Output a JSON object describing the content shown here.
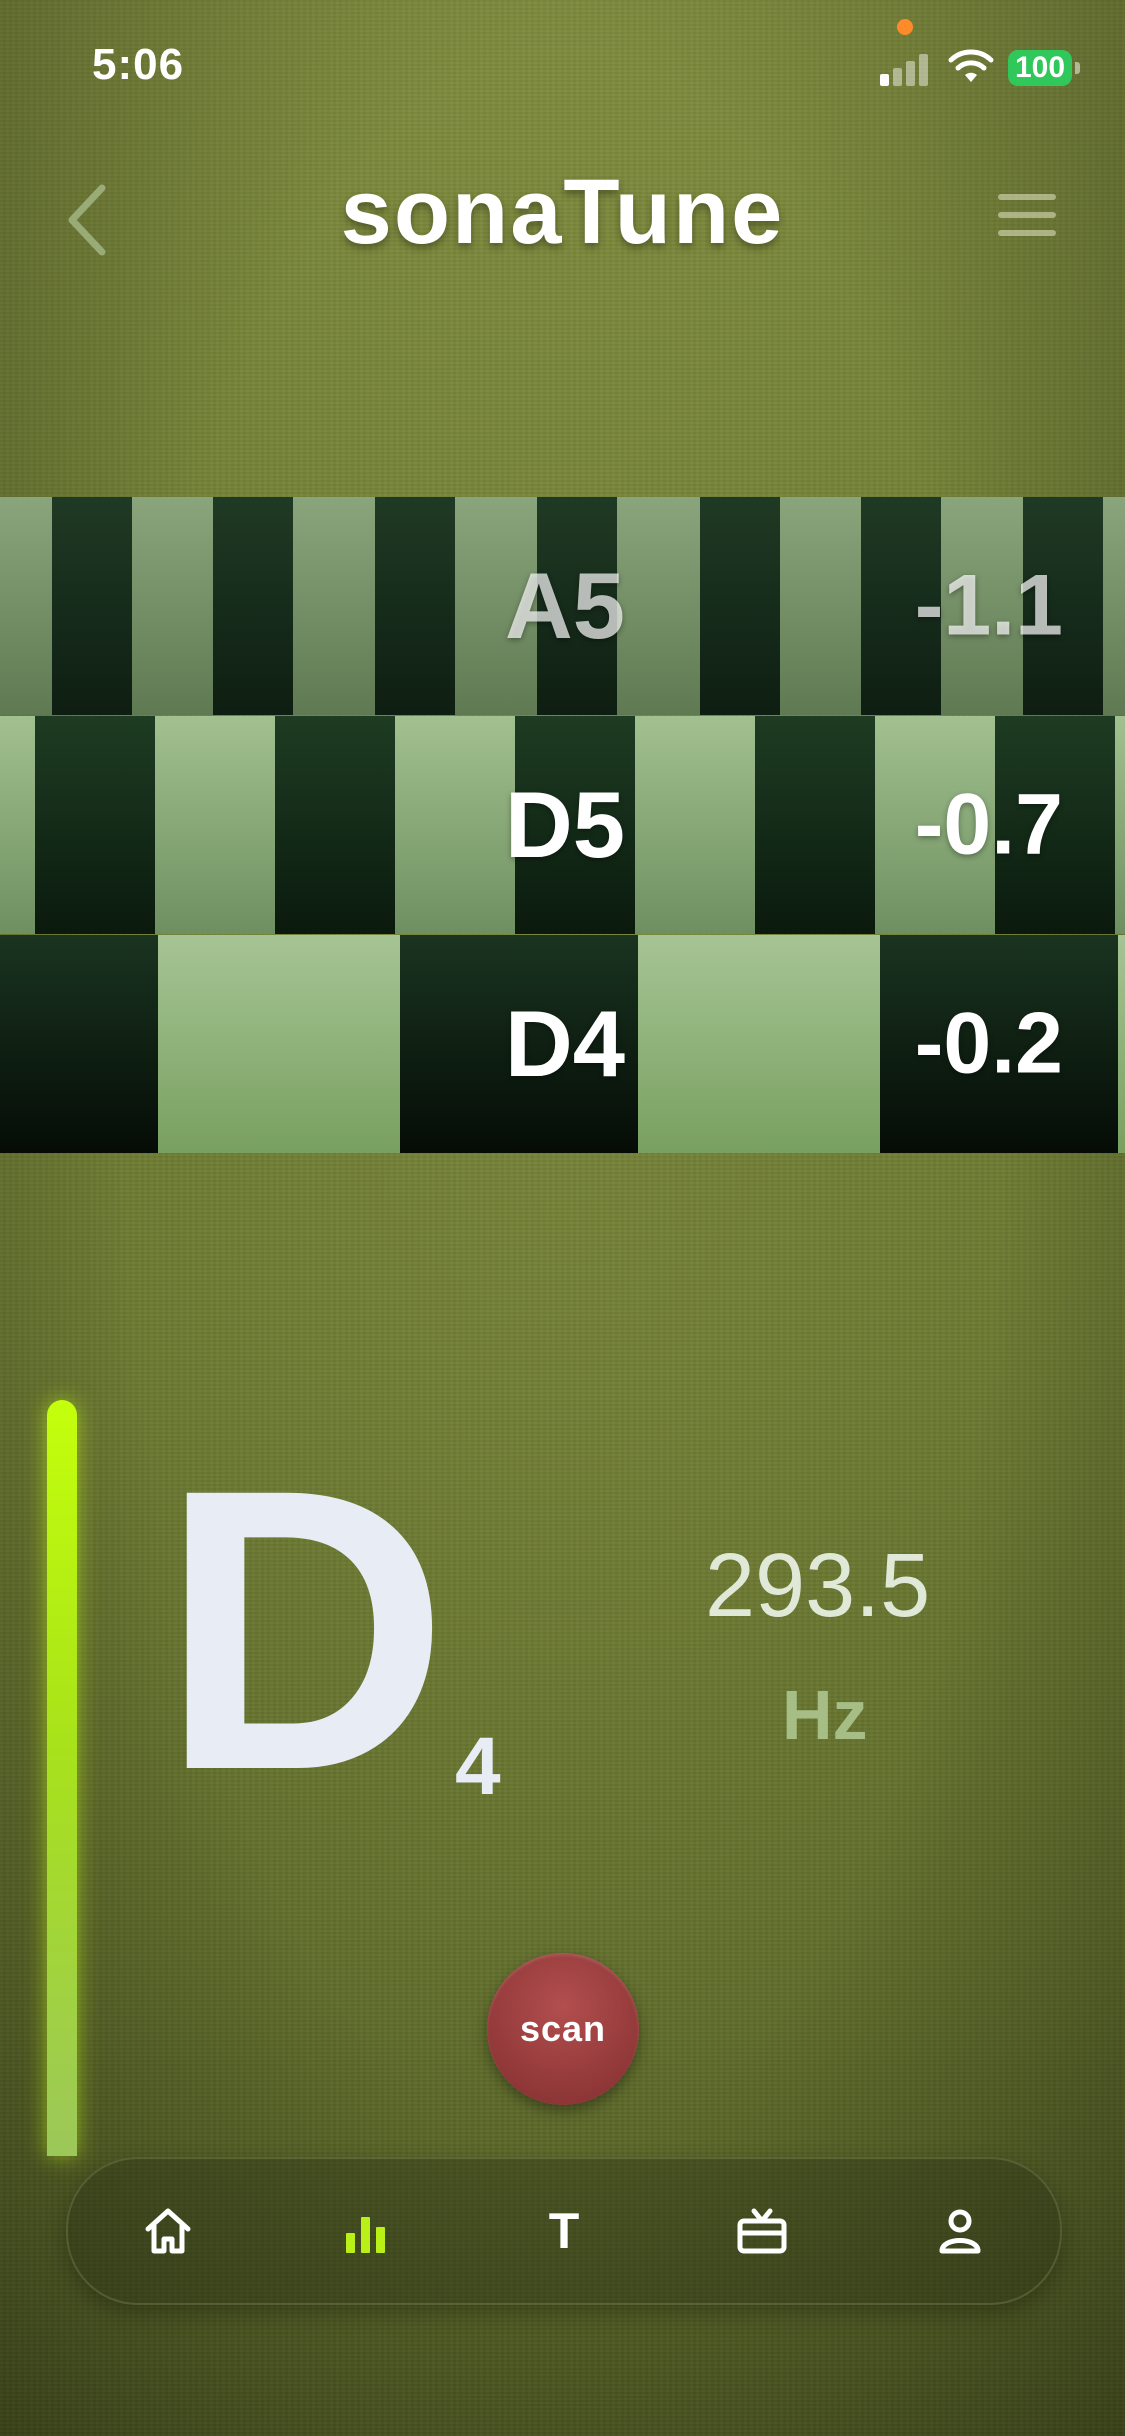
{
  "status_bar": {
    "time": "5:06",
    "battery": "100",
    "icons": [
      "signal-icon",
      "wifi-icon",
      "battery-icon"
    ]
  },
  "header": {
    "title": "sonaTune",
    "back_icon": "chevron-left-icon",
    "menu_icon": "hamburger-menu-icon"
  },
  "recent_notes": [
    {
      "note": "A5",
      "cents": "-1.1"
    },
    {
      "note": "D5",
      "cents": "-0.7"
    },
    {
      "note": "D4",
      "cents": "-0.2"
    }
  ],
  "tuner": {
    "note": "D",
    "octave": "4",
    "frequency": "293.5",
    "unit": "Hz",
    "level": 0.96
  },
  "scan_button": {
    "label": "scan"
  },
  "tab_bar": {
    "items": [
      {
        "name": "home",
        "icon": "home-icon",
        "active": false
      },
      {
        "name": "tuner",
        "icon": "bar-chart-icon",
        "active": true
      },
      {
        "name": "text",
        "icon": "text-icon",
        "label": "T",
        "active": false
      },
      {
        "name": "gifts",
        "icon": "gift-icon",
        "active": false
      },
      {
        "name": "profile",
        "icon": "user-icon",
        "active": false
      }
    ]
  },
  "colors": {
    "background": "#6f7e33",
    "level_bar": "#c4ff0c",
    "scan_button": "#9e3f40",
    "active_tab": "#b8f018",
    "battery": "#30c85a",
    "mic_indicator": "#ff8a2a"
  }
}
